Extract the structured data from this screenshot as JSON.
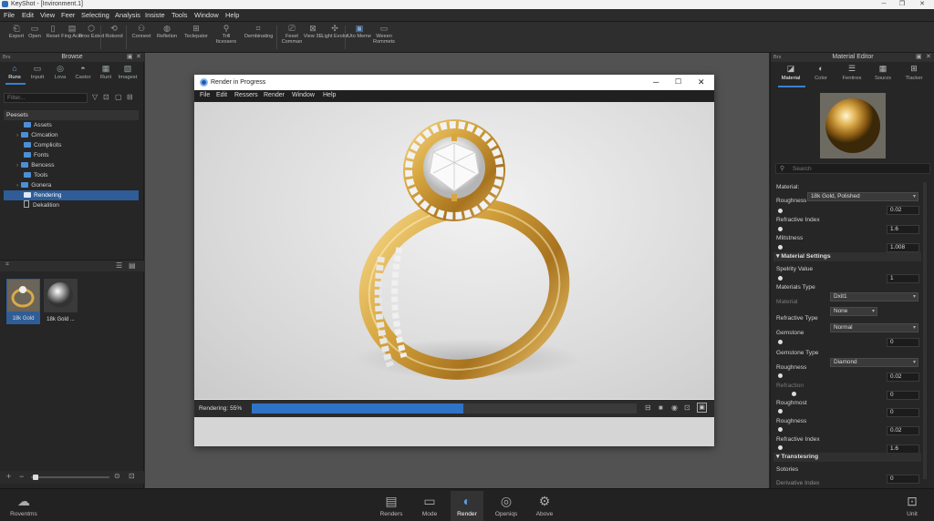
{
  "window": {
    "title": "KeyShot - [Invironment.1]"
  },
  "menu": [
    "File",
    "Edit",
    "View",
    "Feer",
    "Selecting",
    "Analysis",
    "Insiste",
    "Tools",
    "Window",
    "Help"
  ],
  "toolbar": [
    {
      "label": "Export",
      "icon": "import-icon"
    },
    {
      "label": "Open",
      "icon": "open-icon"
    },
    {
      "label": "Reset",
      "icon": "reset-icon"
    },
    {
      "label": "Fing Acer",
      "icon": "fing-icon"
    },
    {
      "label": "Tiroo Exted",
      "icon": "cube-icon"
    },
    {
      "label": "Rokond",
      "icon": "rotate-icon"
    },
    {
      "label": "Connext",
      "icon": "connect-icon"
    },
    {
      "label": "Refletion",
      "icon": "reflection-icon"
    },
    {
      "label": "Teclepator",
      "icon": "teleport-icon"
    },
    {
      "label": "Trill Itcessers",
      "icon": "person-icon"
    },
    {
      "label": "Dembinating",
      "icon": "dimensions-icon"
    },
    {
      "label": "Feset Comman",
      "icon": "reset-camera-icon"
    },
    {
      "label": "View 3E",
      "icon": "view3d-icon"
    },
    {
      "label": "Light Evolut",
      "icon": "light-icon"
    },
    {
      "label": "Uto Meme",
      "icon": "phone-icon"
    },
    {
      "label": "Weeen Rommets",
      "icon": "window-icon"
    }
  ],
  "left": {
    "title": "Browse",
    "corner": "Brs",
    "tabs": [
      {
        "label": "Runs",
        "icon": "home-icon"
      },
      {
        "label": "Inputt",
        "icon": "input-icon"
      },
      {
        "label": "Lova",
        "icon": "globe-icon"
      },
      {
        "label": "Castor",
        "icon": "castor-icon"
      },
      {
        "label": "Runt",
        "icon": "grid-icon"
      },
      {
        "label": "Imagest",
        "icon": "image-icon"
      }
    ],
    "filter_placeholder": "Filter...",
    "tree_root": "Peesets",
    "tree": [
      "Assets",
      "Cimcation",
      "Complicits",
      "Fonts",
      "Bencess",
      "Tools",
      "Gonera",
      "Rendering",
      "Dekalition"
    ],
    "selected_item": "Rendering",
    "thumbs": [
      "18k Gold",
      "18k Gold ..."
    ]
  },
  "render": {
    "title": "Render in Progress",
    "menu": [
      "File",
      "Edit",
      "Ressers",
      "Render",
      "Window",
      "Help"
    ],
    "status_label": "Rendering: 55%",
    "progress": 0.55
  },
  "right": {
    "title": "Material Editor",
    "corner": "Brs",
    "tabs": [
      {
        "label": "Material",
        "icon": "material-icon"
      },
      {
        "label": "Color",
        "icon": "color-icon"
      },
      {
        "label": "Fentires",
        "icon": "features-icon"
      },
      {
        "label": "Sourzs",
        "icon": "sources-icon"
      },
      {
        "label": "Tlacker",
        "icon": "tracker-icon"
      }
    ],
    "search_placeholder": "Search",
    "material_label": "Material:",
    "material_value": "18k Gold, Polished",
    "props1": [
      {
        "label": "Roughness",
        "value": "0.02"
      },
      {
        "label": "Refractive Index",
        "value": "1.6"
      },
      {
        "label": "Mlitstness",
        "value": "1.008"
      }
    ],
    "section1": "Material Settings",
    "spec_label": "Spelrity Value",
    "spec_value": "1",
    "mtype_label": "Materials Type",
    "mtype_value": "Dxit1",
    "material2_label": "Material",
    "material2_value": "None",
    "rtype_label": "Refractive Type",
    "rtype_value": "Normal",
    "gem_label": "Gemstone",
    "gem_value": "0",
    "gtype_label": "Gemstone Type",
    "gtype_value": "Diamond",
    "props2": [
      {
        "label": "Roughness",
        "value": "0.02"
      },
      {
        "label": "Refraction",
        "value": "0"
      },
      {
        "label": "Roughmost",
        "value": "0"
      },
      {
        "label": "Roughness",
        "value": "0.02"
      },
      {
        "label": "Refractive Index",
        "value": "1.6"
      }
    ],
    "section2": "Transtesring",
    "sot_label": "Sotories",
    "sot_value": "0",
    "cut_label": "Derivative Index",
    "cut_value": "0"
  },
  "bottom": {
    "left_label": "Roventms",
    "items": [
      {
        "label": "Renders",
        "icon": "renders-icon"
      },
      {
        "label": "Mode",
        "icon": "mode-icon"
      },
      {
        "label": "Render",
        "icon": "render-icon"
      },
      {
        "label": "Openiqs",
        "icon": "openings-icon"
      },
      {
        "label": "Above",
        "icon": "gear-icon"
      }
    ],
    "right_label": "Unit"
  }
}
